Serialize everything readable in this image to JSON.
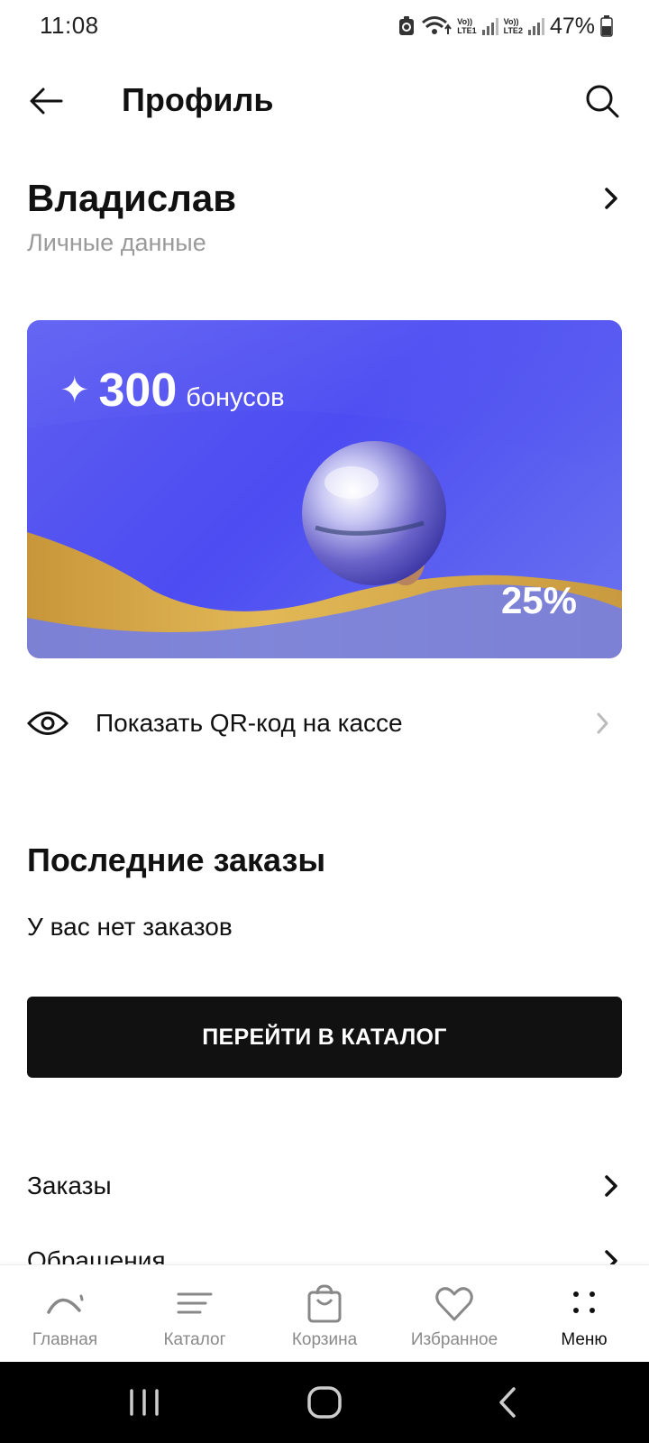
{
  "status_bar": {
    "time": "11:08",
    "battery": "47%",
    "sim1": "Vo)) LTE1",
    "sim2": "Vo)) LTE2",
    "icons": [
      "recycle-icon",
      "wifi-icon",
      "signal-icon",
      "battery-icon"
    ]
  },
  "header": {
    "title": "Профиль",
    "back_icon": "arrow-left-icon",
    "search_icon": "search-icon"
  },
  "profile": {
    "name": "Владислав",
    "subtitle": "Личные данные"
  },
  "bonus_card": {
    "amount": "300",
    "unit": "бонусов",
    "percent": "25%",
    "colors": {
      "background": "#5b5cf0",
      "wave": "#d8a93c"
    }
  },
  "qr": {
    "label": "Показать QR-код на кассе"
  },
  "orders": {
    "title": "Последние заказы",
    "empty_text": "У вас нет заказов",
    "catalog_button": "ПЕРЕЙТИ В КАТАЛОГ"
  },
  "menu": {
    "items": [
      {
        "label": "Заказы"
      },
      {
        "label": "Обращения"
      }
    ]
  },
  "bottom_nav": {
    "items": [
      {
        "label": "Главная",
        "icon": "home-arc-icon"
      },
      {
        "label": "Каталог",
        "icon": "catalog-lines-icon"
      },
      {
        "label": "Корзина",
        "icon": "bag-icon"
      },
      {
        "label": "Избранное",
        "icon": "heart-icon"
      },
      {
        "label": "Меню",
        "icon": "dots-menu-icon"
      }
    ],
    "active": "Меню"
  }
}
